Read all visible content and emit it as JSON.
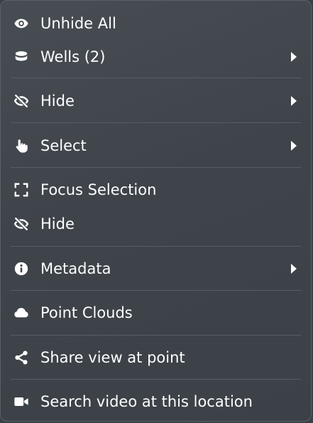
{
  "menu": {
    "items": [
      {
        "label": "Unhide All",
        "icon": "eye-icon",
        "submenu": false
      },
      {
        "label": "Wells (2)",
        "icon": "database-icon",
        "submenu": true
      },
      {
        "label": "Hide",
        "icon": "eye-slash-icon",
        "submenu": true
      },
      {
        "label": "Select",
        "icon": "pointer-hand-icon",
        "submenu": true
      },
      {
        "label": "Focus Selection",
        "icon": "focus-brackets-icon",
        "submenu": false
      },
      {
        "label": "Hide",
        "icon": "eye-slash-icon",
        "submenu": false
      },
      {
        "label": "Metadata",
        "icon": "info-icon",
        "submenu": true
      },
      {
        "label": "Point Clouds",
        "icon": "cloud-icon",
        "submenu": false
      },
      {
        "label": "Share view at point",
        "icon": "share-icon",
        "submenu": false
      },
      {
        "label": "Search video at this location",
        "icon": "video-camera-icon",
        "submenu": false
      }
    ]
  },
  "colors": {
    "background": "#3e444a",
    "text": "#ffffff",
    "separator": "#575d63"
  }
}
